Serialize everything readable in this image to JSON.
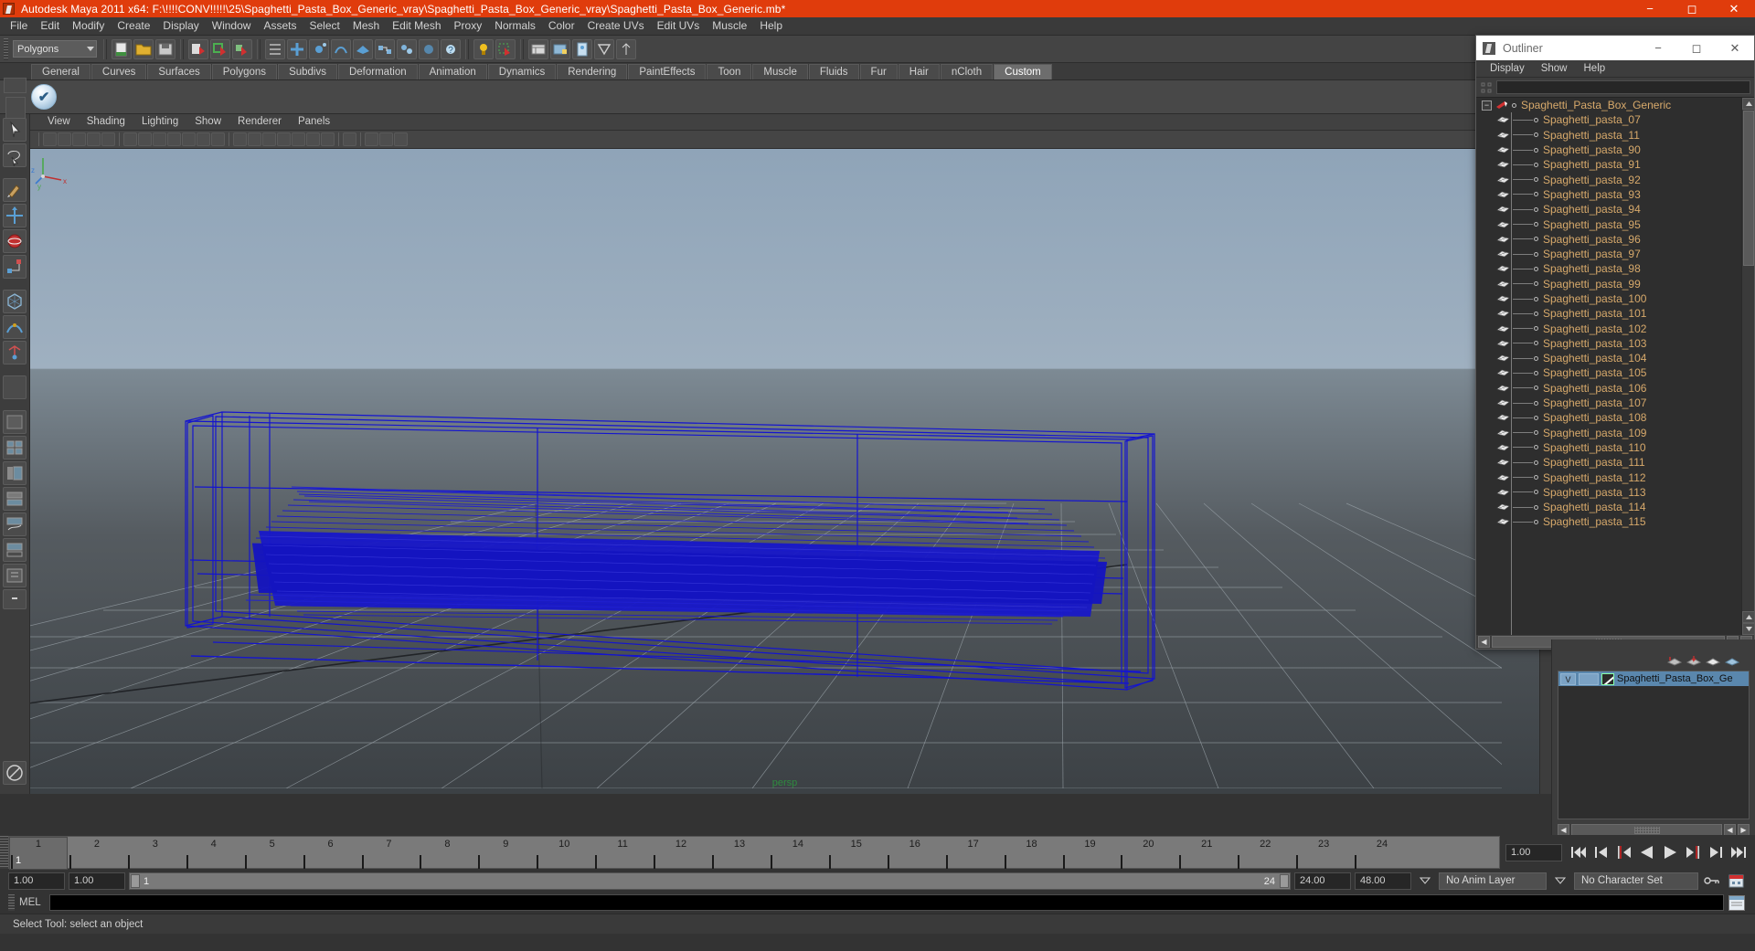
{
  "window": {
    "title": "Autodesk Maya 2011 x64: F:\\!!!!CONV!!!!!\\25\\Spaghetti_Pasta_Box_Generic_vray\\Spaghetti_Pasta_Box_Generic_vray\\Spaghetti_Pasta_Box_Generic.mb*",
    "icon": "maya-app-icon",
    "minimize": "−",
    "maximize": "◻",
    "close": "✕",
    "titlebar_color": "#e03c0c"
  },
  "menubar": {
    "items": [
      {
        "label": "File"
      },
      {
        "label": "Edit"
      },
      {
        "label": "Modify"
      },
      {
        "label": "Create"
      },
      {
        "label": "Display"
      },
      {
        "label": "Window"
      },
      {
        "label": "Assets"
      },
      {
        "label": "Select"
      },
      {
        "label": "Mesh"
      },
      {
        "label": "Edit Mesh"
      },
      {
        "label": "Proxy"
      },
      {
        "label": "Normals"
      },
      {
        "label": "Color"
      },
      {
        "label": "Create UVs"
      },
      {
        "label": "Edit UVs"
      },
      {
        "label": "Muscle"
      },
      {
        "label": "Help"
      }
    ]
  },
  "statusline": {
    "mode_selector": "Polygons"
  },
  "shelf": {
    "tabs": [
      {
        "label": "General",
        "active": false
      },
      {
        "label": "Curves",
        "active": false
      },
      {
        "label": "Surfaces",
        "active": false
      },
      {
        "label": "Polygons",
        "active": false
      },
      {
        "label": "Subdivs",
        "active": false
      },
      {
        "label": "Deformation",
        "active": false
      },
      {
        "label": "Animation",
        "active": false
      },
      {
        "label": "Dynamics",
        "active": false
      },
      {
        "label": "Rendering",
        "active": false
      },
      {
        "label": "PaintEffects",
        "active": false
      },
      {
        "label": "Toon",
        "active": false
      },
      {
        "label": "Muscle",
        "active": false
      },
      {
        "label": "Fluids",
        "active": false
      },
      {
        "label": "Fur",
        "active": false
      },
      {
        "label": "Hair",
        "active": false
      },
      {
        "label": "nCloth",
        "active": false
      },
      {
        "label": "Custom",
        "active": true
      }
    ]
  },
  "viewport": {
    "menu": [
      {
        "label": "View"
      },
      {
        "label": "Shading"
      },
      {
        "label": "Lighting"
      },
      {
        "label": "Show"
      },
      {
        "label": "Renderer"
      },
      {
        "label": "Panels"
      }
    ],
    "camera_label": "persp",
    "axis": {
      "x": "x",
      "y": "y",
      "z": "z"
    },
    "wireframe_color": "#1414c8",
    "selection_color": "#1a1aff"
  },
  "outliner": {
    "title": "Outliner",
    "icon": "maya-app-icon",
    "minimize": "−",
    "maximize": "◻",
    "close": "✕",
    "menu": [
      {
        "label": "Display"
      },
      {
        "label": "Show"
      },
      {
        "label": "Help"
      }
    ],
    "search_value": "",
    "root": "Spaghetti_Pasta_Box_Generic",
    "items": [
      "Spaghetti_pasta_07",
      "Spaghetti_pasta_11",
      "Spaghetti_pasta_90",
      "Spaghetti_pasta_91",
      "Spaghetti_pasta_92",
      "Spaghetti_pasta_93",
      "Spaghetti_pasta_94",
      "Spaghetti_pasta_95",
      "Spaghetti_pasta_96",
      "Spaghetti_pasta_97",
      "Spaghetti_pasta_98",
      "Spaghetti_pasta_99",
      "Spaghetti_pasta_100",
      "Spaghetti_pasta_101",
      "Spaghetti_pasta_102",
      "Spaghetti_pasta_103",
      "Spaghetti_pasta_104",
      "Spaghetti_pasta_105",
      "Spaghetti_pasta_106",
      "Spaghetti_pasta_107",
      "Spaghetti_pasta_108",
      "Spaghetti_pasta_109",
      "Spaghetti_pasta_110",
      "Spaghetti_pasta_111",
      "Spaghetti_pasta_112",
      "Spaghetti_pasta_113",
      "Spaghetti_pasta_114",
      "Spaghetti_pasta_115"
    ],
    "text_color": "#d7a96b"
  },
  "layer_editor": {
    "visibility_toggle": "V",
    "layer_name": "Spaghetti_Pasta_Box_Ge",
    "row_color": "#5a87ad"
  },
  "timeline": {
    "start": 1,
    "end": 24,
    "current": 1,
    "current_field": "1.00",
    "ticks": [
      1,
      2,
      3,
      4,
      5,
      6,
      7,
      8,
      9,
      10,
      11,
      12,
      13,
      14,
      15,
      16,
      17,
      18,
      19,
      20,
      21,
      22,
      23,
      24
    ],
    "playback_buttons": [
      "go-to-start",
      "step-back-key",
      "step-back-frame",
      "play-backwards",
      "play-forwards",
      "step-forward-frame",
      "step-forward-key",
      "go-to-end"
    ]
  },
  "range_slider": {
    "anim_start": "1.00",
    "range_start": "1.00",
    "track_start_label": "1",
    "track_end_label": "24",
    "range_end": "24.00",
    "anim_end": "48.00",
    "anim_layer": "No Anim Layer",
    "character_set": "No Character Set"
  },
  "command_line": {
    "label": "MEL",
    "value": ""
  },
  "statusbar": {
    "message": "Select Tool: select an object"
  }
}
